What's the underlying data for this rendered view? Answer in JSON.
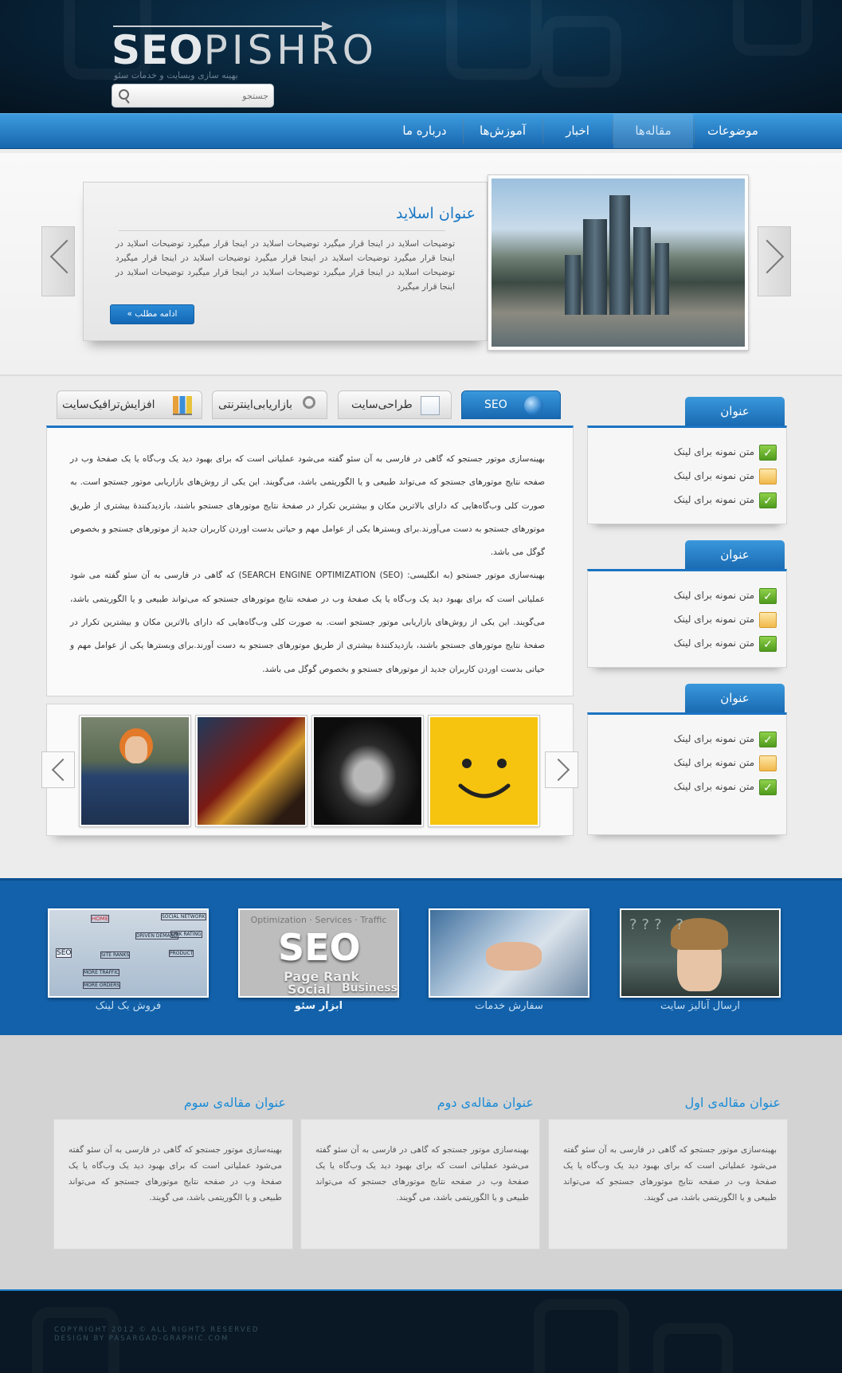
{
  "header": {
    "logo_text_bold": "SEO",
    "logo_text_light": "PISHRO",
    "tagline": "بهینه سازی وبسایت و خدمات سئو",
    "search_placeholder": "جستجو"
  },
  "nav": {
    "items": [
      "موضوعات",
      "مقاله‌ها",
      "اخبار",
      "آموزش‌ها",
      "درباره ما"
    ],
    "active_index": 1
  },
  "slider": {
    "title": "عنوان اسلاید",
    "description": "توضیحات اسلاید در اینجا قرار میگیرد توضیحات اسلاید در اینجا قرار میگیرد توضیحات اسلاید در اینجا قرار میگیرد توضیحات اسلاید در اینجا قرار میگیرد توضیحات اسلاید در اینجا قرار میگیرد توضیحات اسلاید در اینجا قرار میگیرد توضیحات اسلاید در اینجا قرار میگیرد توضیحات اسلاید در اینجا قرار میگیرد",
    "read_more": "ادامه مطلب »"
  },
  "tabs": [
    {
      "label": "SEO",
      "icon": "globe-icon",
      "active": true
    },
    {
      "label": "طراحی‌سایت",
      "icon": "document-icon",
      "active": false
    },
    {
      "label": "بازاریابی‌اینترنتی",
      "icon": "magnifier-icon",
      "active": false
    },
    {
      "label": "افزایش‌ترافیک‌سایت",
      "icon": "bar-chart-icon",
      "active": false
    }
  ],
  "content": {
    "paragraph_1": "بهینه‌سازی موتور جستجو که گاهی در فارسی به آن سئو گفته می‌شود عملیاتی است که برای بهبود دید یک وب‌گاه یا یک صفحهٔ وب در صفحه نتایج موتورهای جستجو که می‌تواند طبیعی و یا الگوریتمی باشد، می‌گویند. این یکی از روش‌های بازاریابی موتور جستجو است. به صورت کلی وب‌گاه‌هایی که دارای بالاترین مکان و بیشترین تکرار در صفحهٔ نتایج موتورهای جستجو باشند، بازدیدکنندهٔ بیشتری از طریق موتورهای جستجو به دست می‌آورند.برای وبسترها یکی از عوامل مهم و حیاتی بدست اوردن کاربران جدید از موتورهای جستجو و بخصوص گوگل می باشد.",
    "paragraph_2": "بهینه‌سازی موتور جستجو (به انگلیسی: SEARCH ENGINE OPTIMIZATION (SEO)) که گاهی در فارسی به آن سئو گفته می شود عملیاتی است که برای بهبود دید یک وب‌گاه یا یک صفحهٔ وب در صفحه نتایج موتورهای جستجو که می‌تواند طبیعی و یا الگوریتمی باشد، می‌گویند. این یکی از روش‌های بازاریابی موتور جستجو است. به صورت کلی وب‌گاه‌هایی که دارای بالاترین مکان و بیشترین تکرار در صفحهٔ نتایج موتورهای جستجو باشند، بازدیدکنندهٔ بیشتری از طریق موتورهای جستجو به دست آورند.برای وبسترها یکی از عوامل مهم و حیاتی بدست اوردن کاربران جدید از موتورهای جستجو و بخصوص گوگل می باشد."
  },
  "gallery": {
    "thumbs": [
      "smiley-face-icon",
      "curly-hair-portrait",
      "iron-man-poster",
      "red-hair-woman"
    ]
  },
  "sidebar": {
    "boxes": [
      {
        "title": "عنوان",
        "items": [
          {
            "label": "متن نمونه برای لینک",
            "icon": "check-icon"
          },
          {
            "label": "متن نمونه برای لینک",
            "icon": "note-icon"
          },
          {
            "label": "متن نمونه برای لینک",
            "icon": "check-icon"
          }
        ]
      },
      {
        "title": "عنوان",
        "items": [
          {
            "label": "متن نمونه برای لینک",
            "icon": "check-icon"
          },
          {
            "label": "متن نمونه برای لینک",
            "icon": "note-icon"
          },
          {
            "label": "متن نمونه برای لینک",
            "icon": "check-icon"
          }
        ]
      },
      {
        "title": "عنوان",
        "items": [
          {
            "label": "متن نمونه برای لینک",
            "icon": "check-icon"
          },
          {
            "label": "متن نمونه برای لینک",
            "icon": "note-icon"
          },
          {
            "label": "متن نمونه برای لینک",
            "icon": "check-icon"
          }
        ]
      }
    ]
  },
  "services": [
    {
      "label": "ارسال آنالیز سایت",
      "bold": false
    },
    {
      "label": "سفارش خدمات",
      "bold": false
    },
    {
      "label": "ابزار سئو",
      "bold": true,
      "image_text": "SEO",
      "image_words": [
        "Page Rank",
        "Social",
        "Business"
      ]
    },
    {
      "label": "فروش بک لینک",
      "bold": false,
      "diagram_words": [
        "HOME",
        "SEO",
        "DRIVEN DEMAND",
        "LINK RATING",
        "SITE RANKS",
        "MORE TRAFFIC",
        "MORE ORDERS",
        "SOCIAL NETWORK",
        "PRODUCT"
      ]
    }
  ],
  "articles": [
    {
      "title": "عنوان مقاله‌ی اول",
      "text": "بهینه‌سازی موتور جستجو که گاهی در فارسی به آن سئو گفته می‌شود عملیاتی است که برای بهبود دید یک وب‌گاه یا یک صفحهٔ وب در صفحه نتایج موتورهای جستجو که می‌تواند طبیعی و یا الگوریتمی باشد، می گویند."
    },
    {
      "title": "عنوان مقاله‌ی دوم",
      "text": "بهینه‌سازی موتور جستجو که گاهی در فارسی به آن سئو گفته می‌شود عملیاتی است که برای بهبود دید یک وب‌گاه یا یک صفحهٔ وب در صفحه نتایج موتورهای جستجو که می‌تواند طبیعی و یا الگوریتمی باشد، می گویند."
    },
    {
      "title": "عنوان مقاله‌ی سوم",
      "text": "بهینه‌سازی موتور جستجو که گاهی در فارسی به آن سئو گفته می‌شود عملیاتی است که برای بهبود دید یک وب‌گاه یا یک صفحهٔ وب در صفحه نتایج موتورهای جستجو که می‌تواند طبیعی و یا الگوریتمی باشد، می گویند."
    }
  ],
  "footer": {
    "copyright_line1": "COPYRIGHT 2012 © ALL RIGHTS RESERVED",
    "copyright_line2": "DESIGN BY PASARGAD-GRAPHIC.COM"
  },
  "colors": {
    "brand_blue": "#1b74c2",
    "nav_top": "#3d9bde",
    "header_dark": "#082338",
    "accent_title": "#1b8bd6"
  }
}
